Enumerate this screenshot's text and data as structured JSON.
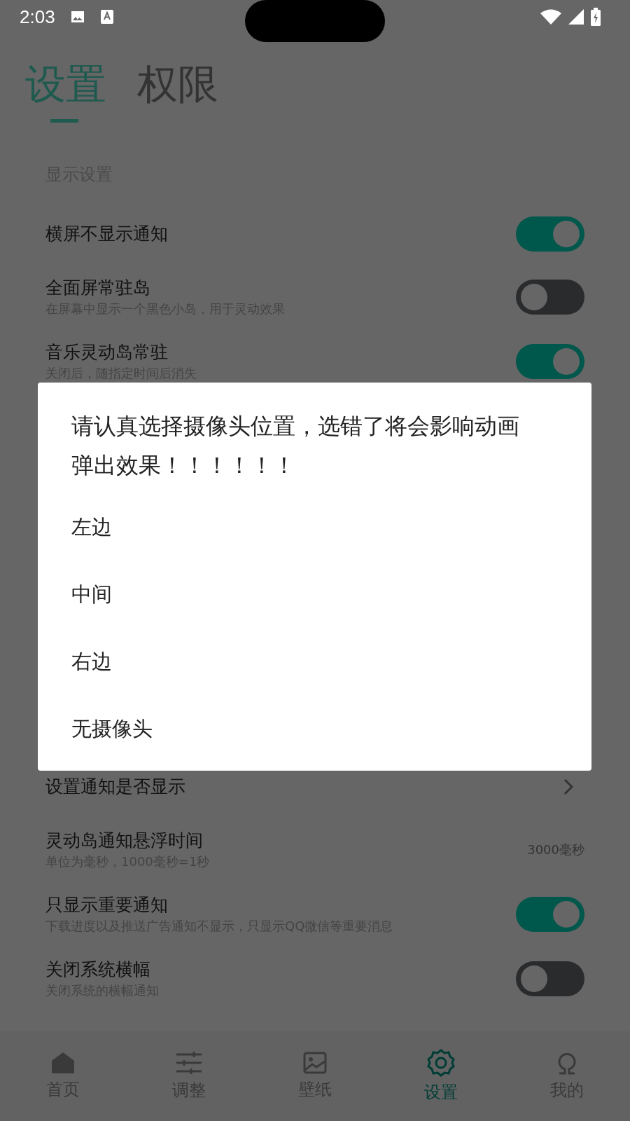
{
  "status_bar": {
    "time": "2:03"
  },
  "tabs": [
    {
      "label": "设置",
      "selected": true
    },
    {
      "label": "权限",
      "selected": false
    }
  ],
  "section": {
    "title": "显示设置"
  },
  "rows_top": [
    {
      "kind": "toggle",
      "title": "横屏不显示通知",
      "on": true
    },
    {
      "kind": "toggle",
      "title": "全面屏常驻岛",
      "subtitle": "在屏幕中显示一个黑色小岛，用于灵动效果",
      "on": false
    },
    {
      "kind": "toggle",
      "title": "音乐灵动岛常驻",
      "subtitle": "关闭后，随指定时间后消失",
      "on": true
    }
  ],
  "rows_bottom": [
    {
      "kind": "link",
      "title": "设置通知是否显示"
    },
    {
      "kind": "value",
      "title": "灵动岛通知悬浮时间",
      "subtitle": "单位为毫秒，1000毫秒=1秒",
      "value": "3000毫秒"
    },
    {
      "kind": "toggle",
      "title": "只显示重要通知",
      "subtitle": "下载进度以及推送广告通知不显示，只显示QQ微信等重要消息",
      "on": true
    },
    {
      "kind": "toggle",
      "title": "关闭系统横幅",
      "subtitle": "关闭系统的横幅通知",
      "on": false
    }
  ],
  "dialog": {
    "message": "请认真选择摄像头位置，选错了将会影响动画弹出效果！！！！！！",
    "options": [
      "左边",
      "中间",
      "右边",
      "无摄像头"
    ]
  },
  "nav": [
    {
      "kind": "home",
      "label": "首页",
      "selected": false
    },
    {
      "kind": "sliders",
      "label": "调整",
      "selected": false
    },
    {
      "kind": "image",
      "label": "壁纸",
      "selected": false
    },
    {
      "kind": "gear",
      "label": "设置",
      "selected": true
    },
    {
      "kind": "user",
      "label": "我的",
      "selected": false
    }
  ]
}
